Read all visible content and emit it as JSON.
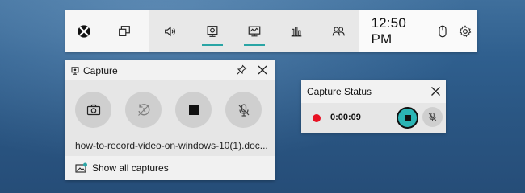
{
  "topbar": {
    "time": "12:50 PM",
    "icons": [
      "xbox-icon",
      "widget-menu-icon",
      "audio-icon",
      "capture-icon",
      "performance-icon",
      "resources-icon",
      "xbox-social-icon",
      "mouse-icon",
      "settings-icon"
    ]
  },
  "capture": {
    "title": "Capture",
    "filename": "how-to-record-video-on-windows-10(1).doc...",
    "show_all": "Show all captures"
  },
  "status": {
    "title": "Capture Status",
    "timer": "0:00:09"
  },
  "colors": {
    "accent": "#2aa5a5",
    "record": "#e81123"
  }
}
